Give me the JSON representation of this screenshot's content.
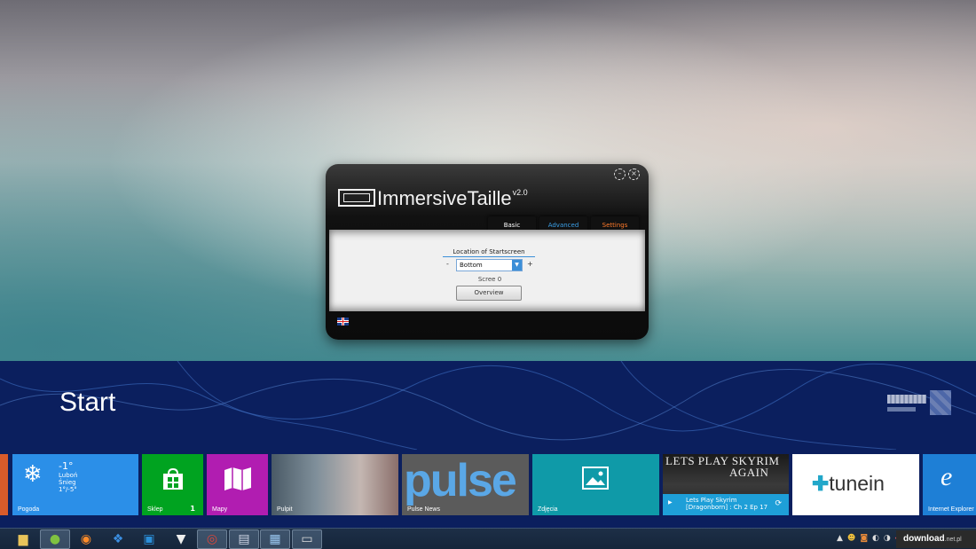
{
  "app": {
    "name": "ImmersiveTaille",
    "version": "v2.0",
    "tabs": [
      {
        "label": "Basic",
        "color": "#ffffff"
      },
      {
        "label": "Advanced",
        "color": "#3ba0e8"
      },
      {
        "label": "Settings",
        "color": "#ff7a2a"
      }
    ],
    "location_label": "Location of Startscreen",
    "location_value": "Bottom",
    "minus": "-",
    "plus": "+",
    "screen_label": "Scree",
    "screen_value": "0",
    "overview_button": "Overview",
    "language_icon": "uk-flag-icon"
  },
  "start": {
    "title": "Start",
    "background_color": "#0b1f5e",
    "tiles": [
      {
        "id": "pogoda",
        "label": "Pogoda",
        "color": "#2b8fe8",
        "temp": "-1°",
        "place": "Luboń",
        "condition": "Śnieg",
        "range": "1°/-5°",
        "icon": "snowflake-icon"
      },
      {
        "id": "sklep",
        "label": "Sklep",
        "color": "#00a320",
        "badge": "1",
        "icon": "store-bag-icon"
      },
      {
        "id": "mapy",
        "label": "Mapy",
        "color": "#b11db1",
        "icon": "map-icon"
      },
      {
        "id": "pulpit",
        "label": "Pulpit",
        "color": "#6a7a88"
      },
      {
        "id": "pulse",
        "label": "Pulse News",
        "color": "#5b5b5b",
        "logo": "pulse"
      },
      {
        "id": "zdjecia",
        "label": "Zdjęcia",
        "color": "#0f9aa8",
        "icon": "photo-icon"
      },
      {
        "id": "skyrim",
        "title_line1": "LETS PLAY SKYRIM",
        "title_line2": "AGAIN",
        "info_line1": "Lets Play Skyrim",
        "info_line2": "[Dragonborn] : Ch 2 Ep 17",
        "color": "#1e9fd8"
      },
      {
        "id": "tunein",
        "color": "#ffffff",
        "logo": "tunein"
      },
      {
        "id": "ie",
        "label": "Internet Explorer",
        "color": "#1e7fd6",
        "icon": "internet-explorer-icon"
      }
    ]
  },
  "taskbar": {
    "items": [
      {
        "name": "file-explorer-icon",
        "glyph": "📁",
        "active": false
      },
      {
        "name": "spotify-icon",
        "glyph": "●",
        "active": true
      },
      {
        "name": "firefox-icon",
        "glyph": "◉",
        "active": false
      },
      {
        "name": "dropbox-icon",
        "glyph": "❖",
        "active": false
      },
      {
        "name": "youtube-app-icon",
        "glyph": "▶",
        "active": false
      },
      {
        "name": "fox-mask-icon",
        "glyph": "▼",
        "active": false
      },
      {
        "name": "chrome-icon",
        "glyph": "◎",
        "active": true
      },
      {
        "name": "floppy-save-icon",
        "glyph": "▣",
        "active": true
      },
      {
        "name": "remote-desktop-icon",
        "glyph": "▤",
        "active": true
      },
      {
        "name": "immersivetaille-app-icon",
        "glyph": "▭",
        "active": true
      }
    ],
    "watermark_main": "download",
    "watermark_suffix": ".net.pl"
  }
}
